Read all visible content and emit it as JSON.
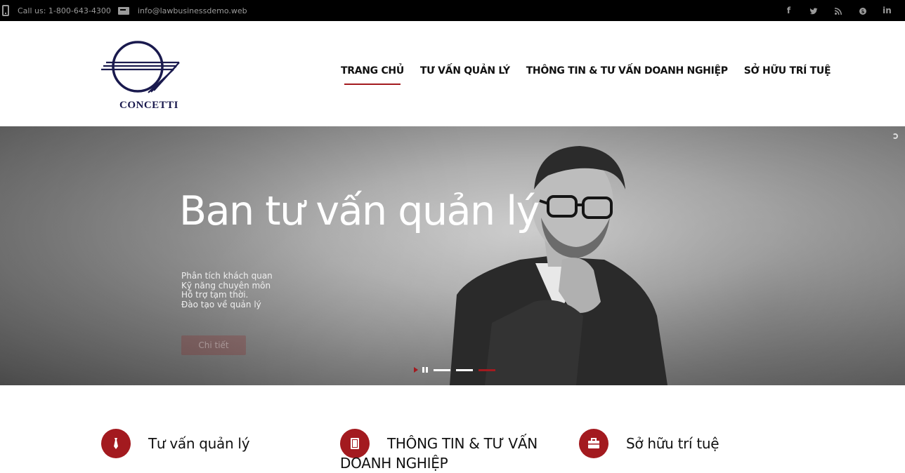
{
  "topbar": {
    "phone": "Call us: 1-800-643-4300",
    "email": "info@lawbusinessdemo.web",
    "social": [
      "facebook-icon",
      "twitter-icon",
      "rss-icon",
      "skype-icon",
      "linkedin-icon"
    ]
  },
  "header": {
    "logo_text": "CONCETTI",
    "nav": [
      {
        "label": "TRANG CHỦ",
        "active": true
      },
      {
        "label": "TƯ VẤN QUẢN LÝ",
        "active": false
      },
      {
        "label": "THÔNG TIN & TƯ VẤN DOANH NGHIỆP",
        "active": false
      },
      {
        "label": "SỞ HỮU TRÍ TUỆ",
        "active": false
      }
    ]
  },
  "hero": {
    "title": "Ban tư vấn quản lý",
    "items": [
      "Phân tích khách quan",
      "Kỹ năng chuyên môn",
      "Hỗ trợ tạm thời.",
      "Đào tạo về quản lý"
    ],
    "button": "Chi tiết",
    "slides_total": 3,
    "slide_active": 3
  },
  "features": [
    {
      "title": "Tư vấn quản lý",
      "icon": "tie-icon"
    },
    {
      "title": "THÔNG TIN & TƯ VẤN DOANH NGHIỆP",
      "icon": "book-icon"
    },
    {
      "title": "Sở hữu trí tuệ",
      "icon": "briefcase-icon"
    }
  ],
  "colors": {
    "accent": "#a31a1f",
    "topbar": "#000000",
    "logo": "#1a1a4e"
  }
}
